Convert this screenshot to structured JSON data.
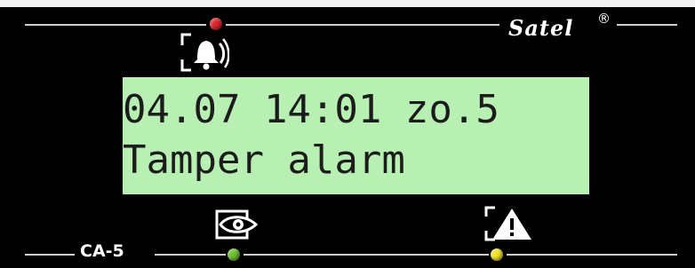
{
  "keypad": {
    "brand": "Satel",
    "brand_mark": "®",
    "model": "CA-5"
  },
  "display": {
    "line1": "04.07 14:01 zo.5",
    "line2": "Tamper alarm"
  },
  "indicators": [
    {
      "icon": "alarm-bell-icon",
      "led_color": "#d9262c"
    },
    {
      "icon": "armed-eye-icon",
      "led_color": "#6cbf2f"
    },
    {
      "icon": "trouble-warning-icon",
      "led_color": "#f0e02a"
    }
  ],
  "colors": {
    "panel": "#000000",
    "lcd_background": "#b8f0b3",
    "lcd_text": "#1c1c1c"
  }
}
